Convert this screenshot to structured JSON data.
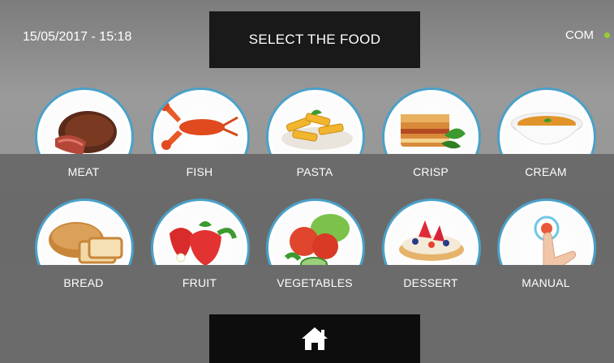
{
  "header": {
    "datetime": "15/05/2017 - 15:18",
    "title": "SELECT THE FOOD",
    "connection_label": "COM",
    "connection_status_color": "#9acd32"
  },
  "foods": [
    {
      "label": "MEAT",
      "icon": "steak-icon"
    },
    {
      "label": "FISH",
      "icon": "lobster-icon"
    },
    {
      "label": "PASTA",
      "icon": "penne-icon"
    },
    {
      "label": "CRISP",
      "icon": "lasagna-icon"
    },
    {
      "label": "CREAM",
      "icon": "soup-bowl-icon"
    },
    {
      "label": "BREAD",
      "icon": "bread-icon"
    },
    {
      "label": "FRUIT",
      "icon": "strawberries-icon"
    },
    {
      "label": "VEGETABLES",
      "icon": "vegetables-icon"
    },
    {
      "label": "DESSERT",
      "icon": "fruit-tart-icon"
    },
    {
      "label": "MANUAL",
      "icon": "hand-touch-icon"
    }
  ],
  "footer": {
    "home_icon": "home-icon"
  },
  "colors": {
    "ring": "#4aa0c8",
    "band": "#6b6b6b",
    "title_bg": "#191919"
  }
}
